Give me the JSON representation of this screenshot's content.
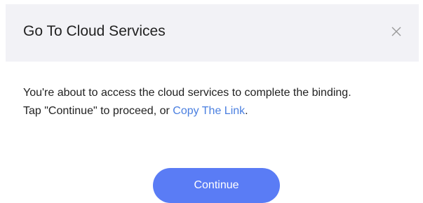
{
  "dialog": {
    "title": "Go To Cloud Services",
    "close_icon": "close-icon",
    "body": {
      "line1": "You're about to access the cloud services to complete the binding.",
      "line2_prefix": "Tap \"Continue\" to proceed, or ",
      "link_label": "Copy The Link",
      "line2_suffix": "."
    },
    "continue_label": "Continue"
  },
  "colors": {
    "header_background": "#f2f2f6",
    "link": "#4a7fe0",
    "primary_button": "#5a7cf5",
    "text": "#222222",
    "close_icon": "#9a9a9a"
  }
}
